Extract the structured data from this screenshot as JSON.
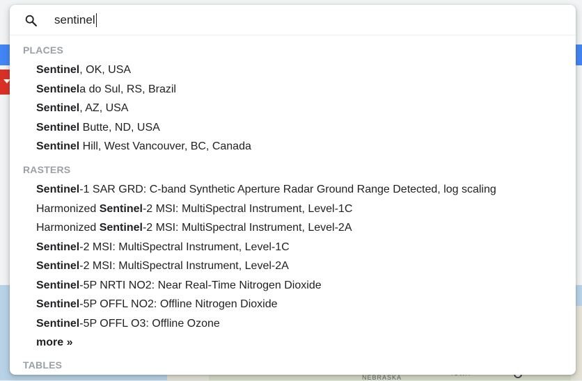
{
  "search": {
    "query": "sentinel"
  },
  "background": {
    "map_labels": [
      "NEBRASKA",
      "IOWA"
    ]
  },
  "sections": [
    {
      "header": "PLACES",
      "items": [
        {
          "match": "Sentinel",
          "pre": "",
          "rest": ", OK, USA"
        },
        {
          "match": "Sentinel",
          "pre": "",
          "rest": "a do Sul, RS, Brazil"
        },
        {
          "match": "Sentinel",
          "pre": "",
          "rest": ", AZ, USA"
        },
        {
          "match": "Sentinel",
          "pre": "",
          "rest": " Butte, ND, USA"
        },
        {
          "match": "Sentinel",
          "pre": "",
          "rest": " Hill, West Vancouver, BC, Canada"
        }
      ]
    },
    {
      "header": "RASTERS",
      "items": [
        {
          "match": "Sentinel",
          "pre": "",
          "rest": "-1 SAR GRD: C-band Synthetic Aperture Radar Ground Range Detected, log scaling"
        },
        {
          "match": "Sentinel",
          "pre": "Harmonized ",
          "rest": "-2 MSI: MultiSpectral Instrument, Level-1C"
        },
        {
          "match": "Sentinel",
          "pre": "Harmonized ",
          "rest": "-2 MSI: MultiSpectral Instrument, Level-2A"
        },
        {
          "match": "Sentinel",
          "pre": "",
          "rest": "-2 MSI: MultiSpectral Instrument, Level-1C"
        },
        {
          "match": "Sentinel",
          "pre": "",
          "rest": "-2 MSI: MultiSpectral Instrument, Level-2A"
        },
        {
          "match": "Sentinel",
          "pre": "",
          "rest": "-5P NRTI NO2: Near Real-Time Nitrogen Dioxide"
        },
        {
          "match": "Sentinel",
          "pre": "",
          "rest": "-5P OFFL NO2: Offline Nitrogen Dioxide"
        },
        {
          "match": "Sentinel",
          "pre": "",
          "rest": "-5P OFFL O3: Offline Ozone"
        }
      ],
      "more_label": "more »"
    },
    {
      "header": "TABLES",
      "items": []
    }
  ],
  "colors": {
    "section_header": "#9aa0a6",
    "text": "#202124",
    "accent_blue": "#4285f4",
    "accent_red": "#d93025"
  }
}
